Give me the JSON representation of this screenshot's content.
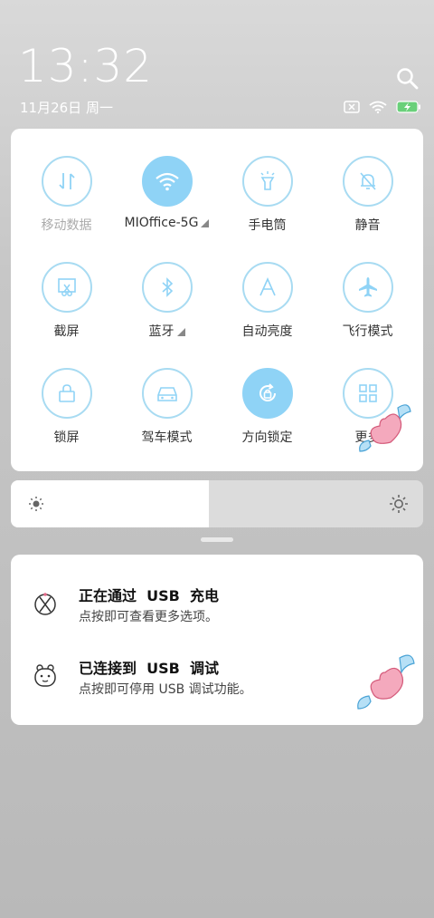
{
  "status_bar": {
    "time": "13:32",
    "date": "11月26日 周一",
    "icons": [
      "sim-off-icon",
      "wifi-icon",
      "battery-charging-icon"
    ]
  },
  "quick_settings": {
    "tiles": [
      {
        "label": "移动数据",
        "icon": "mobile-data-icon",
        "active": false,
        "muted": true
      },
      {
        "label": "MIOffice-5G",
        "icon": "wifi-icon",
        "active": true,
        "has_menu": true
      },
      {
        "label": "手电筒",
        "icon": "flashlight-icon",
        "active": false
      },
      {
        "label": "静音",
        "icon": "bell-off-icon",
        "active": false
      },
      {
        "label": "截屏",
        "icon": "screenshot-icon",
        "active": false
      },
      {
        "label": "蓝牙",
        "icon": "bluetooth-icon",
        "active": false,
        "has_menu": true
      },
      {
        "label": "自动亮度",
        "icon": "auto-brightness-icon",
        "active": false
      },
      {
        "label": "飞行模式",
        "icon": "airplane-icon",
        "active": false
      },
      {
        "label": "锁屏",
        "icon": "lock-icon",
        "active": false
      },
      {
        "label": "驾车模式",
        "icon": "car-icon",
        "active": false
      },
      {
        "label": "方向锁定",
        "icon": "rotation-lock-icon",
        "active": true
      },
      {
        "label": "更多",
        "icon": "grid-icon",
        "active": false
      }
    ]
  },
  "brightness": {
    "level": 0.48
  },
  "notifications": [
    {
      "title": "正在通过  USB  充电",
      "subtitle": "点按即可查看更多选项。",
      "icon": "android-icon"
    },
    {
      "title": "已连接到  USB  调试",
      "subtitle": "点按即可停用 USB 调试功能。",
      "icon": "debug-icon"
    }
  ],
  "colors": {
    "accent": "#8fd3f6",
    "outline": "#a8dbf2"
  }
}
